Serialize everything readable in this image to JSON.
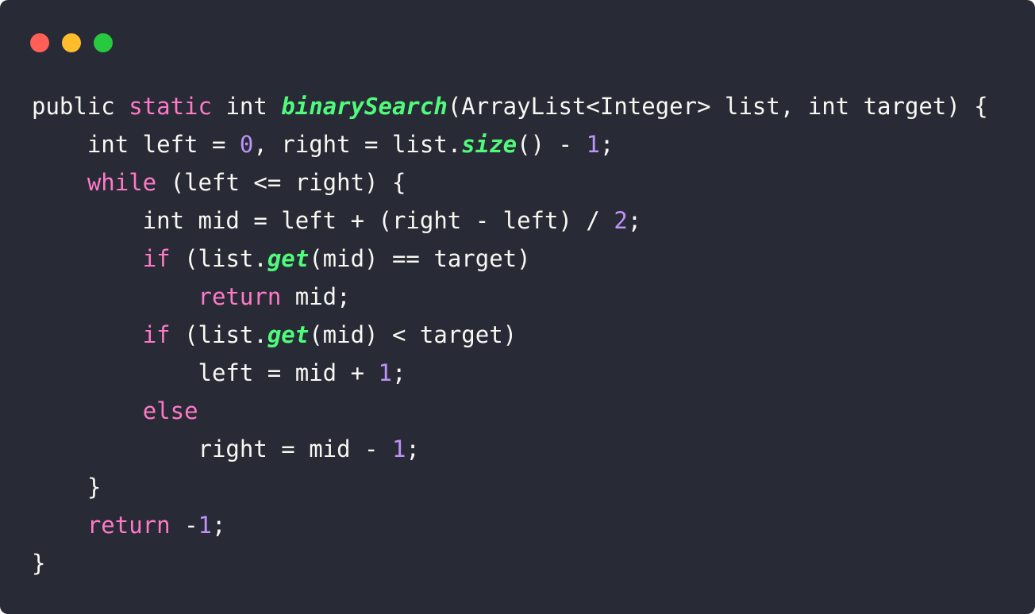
{
  "window": {
    "controls": [
      {
        "name": "close-dot",
        "color": "#ff5f56"
      },
      {
        "name": "minimize-dot",
        "color": "#ffbd2e"
      },
      {
        "name": "maximize-dot",
        "color": "#27c93f"
      }
    ]
  },
  "code": {
    "lines": [
      [
        {
          "t": "public ",
          "c": "plain"
        },
        {
          "t": "static",
          "c": "keyword"
        },
        {
          "t": " int ",
          "c": "plain"
        },
        {
          "t": "binarySearch",
          "c": "func"
        },
        {
          "t": "(ArrayList<Integer> list, int target) {",
          "c": "plain"
        }
      ],
      [
        {
          "t": "    int left = ",
          "c": "plain"
        },
        {
          "t": "0",
          "c": "num"
        },
        {
          "t": ", right = list.",
          "c": "plain"
        },
        {
          "t": "size",
          "c": "func"
        },
        {
          "t": "() - ",
          "c": "plain"
        },
        {
          "t": "1",
          "c": "num"
        },
        {
          "t": ";",
          "c": "plain"
        }
      ],
      [
        {
          "t": "    ",
          "c": "plain"
        },
        {
          "t": "while",
          "c": "keyword"
        },
        {
          "t": " (left <= right) {",
          "c": "plain"
        }
      ],
      [
        {
          "t": "        int mid = left + (right - left) / ",
          "c": "plain"
        },
        {
          "t": "2",
          "c": "num"
        },
        {
          "t": ";",
          "c": "plain"
        }
      ],
      [
        {
          "t": "        ",
          "c": "plain"
        },
        {
          "t": "if",
          "c": "keyword"
        },
        {
          "t": " (list.",
          "c": "plain"
        },
        {
          "t": "get",
          "c": "func"
        },
        {
          "t": "(mid) == target)",
          "c": "plain"
        }
      ],
      [
        {
          "t": "            ",
          "c": "plain"
        },
        {
          "t": "return",
          "c": "keyword"
        },
        {
          "t": " mid;",
          "c": "plain"
        }
      ],
      [
        {
          "t": "        ",
          "c": "plain"
        },
        {
          "t": "if",
          "c": "keyword"
        },
        {
          "t": " (list.",
          "c": "plain"
        },
        {
          "t": "get",
          "c": "func"
        },
        {
          "t": "(mid) < target)",
          "c": "plain"
        }
      ],
      [
        {
          "t": "            left = mid + ",
          "c": "plain"
        },
        {
          "t": "1",
          "c": "num"
        },
        {
          "t": ";",
          "c": "plain"
        }
      ],
      [
        {
          "t": "        ",
          "c": "plain"
        },
        {
          "t": "else",
          "c": "keyword"
        }
      ],
      [
        {
          "t": "            right = mid - ",
          "c": "plain"
        },
        {
          "t": "1",
          "c": "num"
        },
        {
          "t": ";",
          "c": "plain"
        }
      ],
      [
        {
          "t": "    }",
          "c": "plain"
        }
      ],
      [
        {
          "t": "    ",
          "c": "plain"
        },
        {
          "t": "return",
          "c": "keyword"
        },
        {
          "t": " -",
          "c": "plain"
        },
        {
          "t": "1",
          "c": "num"
        },
        {
          "t": ";",
          "c": "plain"
        }
      ],
      [
        {
          "t": "}",
          "c": "plain"
        }
      ]
    ]
  }
}
